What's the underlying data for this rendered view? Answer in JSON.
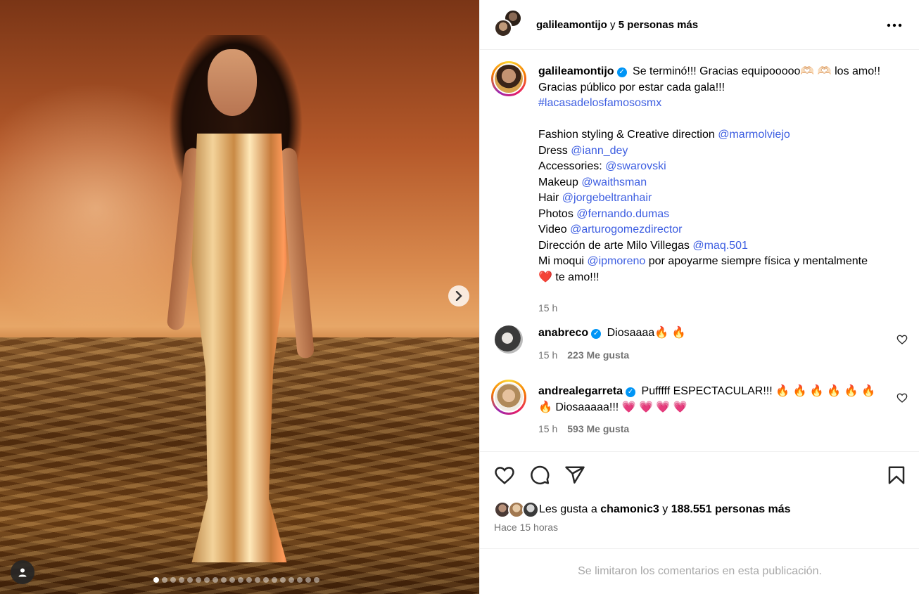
{
  "header": {
    "username": "galileamontijo",
    "joiner": "y",
    "others": "5 personas más",
    "more_label": "•••"
  },
  "caption": {
    "username": "galileamontijo",
    "line1": "Se terminó!!! Gracias equipooooo🫶🏻 🫶🏻 los amo!! Gracias público por estar cada gala!!!",
    "hashtag": "#lacasadelosfamososmx",
    "credits": [
      {
        "label": "Fashion styling & Creative direction ",
        "handle": "@marmolviejo",
        "after": ""
      },
      {
        "label": "Dress ",
        "handle": "@iann_dey",
        "after": ""
      },
      {
        "label": "Accessories: ",
        "handle": "@swarovski",
        "after": ""
      },
      {
        "label": "Makeup ",
        "handle": "@waithsman",
        "after": ""
      },
      {
        "label": "Hair ",
        "handle": "@jorgebeltranhair",
        "after": ""
      },
      {
        "label": "Photos ",
        "handle": "@fernando.dumas",
        "after": ""
      },
      {
        "label": "Video ",
        "handle": "@arturogomezdirector",
        "after": ""
      },
      {
        "label": "Dirección de arte Milo Villegas ",
        "handle": "@maq.501",
        "after": ""
      }
    ],
    "last_pre": "Mi moqui ",
    "last_handle": "@ipmoreno",
    "last_post": " por apoyarme siempre física y mentalmente ❤️ te amo!!!",
    "time": "15 h"
  },
  "comments": [
    {
      "username": "anabreco",
      "text": "Diosaaaa🔥 🔥",
      "time": "15 h",
      "likes": "223 Me gusta"
    },
    {
      "username": "andrealegarreta",
      "text": "Pufffff ESPECTACULAR!!! 🔥 🔥 🔥 🔥 🔥 🔥 🔥 Diosaaaaa!!! 💗 💗 💗 💗",
      "time": "15 h",
      "likes": "593 Me gusta"
    }
  ],
  "likes": {
    "prefix": "Les gusta a",
    "user": "chamonic3",
    "joiner": "y",
    "rest": "188.551 personas más",
    "time_ago": "Hace 15 horas"
  },
  "footer": {
    "limited": "Se limitaron los comentarios en esta publicación."
  },
  "carousel": {
    "total_slides": 20,
    "active_index": 0
  },
  "icons": {
    "verified": "verified-badge-icon",
    "like": "heart-icon",
    "comment": "comment-icon",
    "share": "share-icon",
    "save": "bookmark-icon",
    "next": "chevron-right-icon",
    "tag": "user-tag-icon"
  },
  "colors": {
    "link": "#3d5ee1",
    "verified": "#0095f6",
    "muted": "#737373",
    "footer_text": "#a8a8a8"
  }
}
